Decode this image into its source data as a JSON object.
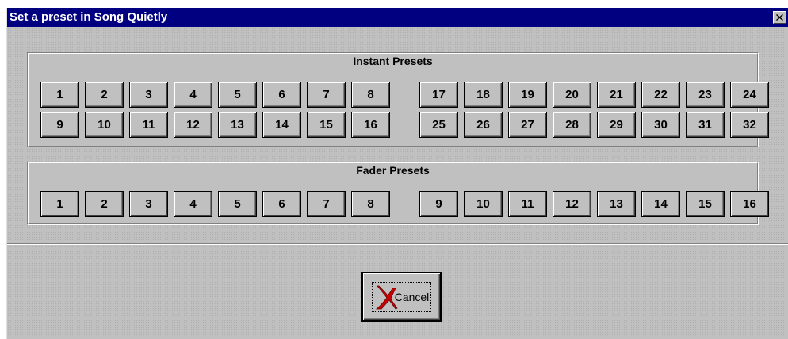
{
  "window": {
    "title": "Set a preset in Song Quietly",
    "close_icon": "close-icon"
  },
  "instant_presets": {
    "title": "Instant Presets",
    "buttons": [
      "1",
      "2",
      "3",
      "4",
      "5",
      "6",
      "7",
      "8",
      "17",
      "18",
      "19",
      "20",
      "21",
      "22",
      "23",
      "24",
      "9",
      "10",
      "11",
      "12",
      "13",
      "14",
      "15",
      "16",
      "25",
      "26",
      "27",
      "28",
      "29",
      "30",
      "31",
      "32"
    ]
  },
  "fader_presets": {
    "title": "Fader Presets",
    "buttons": [
      "1",
      "2",
      "3",
      "4",
      "5",
      "6",
      "7",
      "8",
      "9",
      "10",
      "11",
      "12",
      "13",
      "14",
      "15",
      "16"
    ]
  },
  "cancel": {
    "label": "Cancel",
    "icon": "red-x-icon",
    "icon_color": "#cc0000"
  },
  "colors": {
    "titlebar": "#000080",
    "face": "#c0c0c0"
  }
}
